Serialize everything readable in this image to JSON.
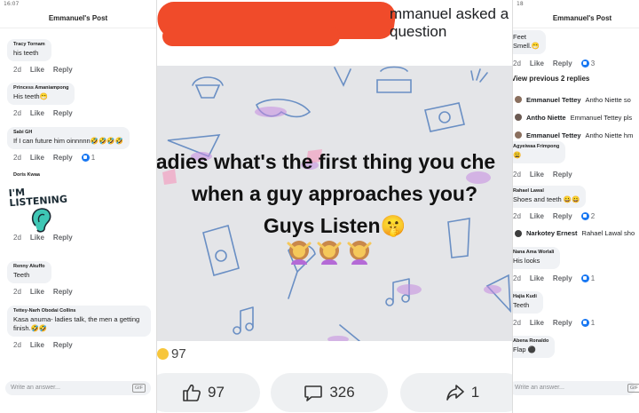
{
  "left_panel": {
    "status_time": "16:07",
    "header": "Emmanuel's Post",
    "comments": [
      {
        "name": "Tracy Tornam",
        "text": "his teeth",
        "time": "2d",
        "like": "Like",
        "reply": "Reply",
        "reactions": ""
      },
      {
        "name": "Princess Amaniampong",
        "text": "His teeth😁",
        "time": "2d",
        "like": "Like",
        "reply": "Reply",
        "reactions": ""
      },
      {
        "name": "Sabi GH",
        "text": "If I can future him oinnnnn🤣🤣🤣🤣",
        "time": "2d",
        "like": "Like",
        "reply": "Reply",
        "reactions": "1"
      },
      {
        "name": "Doris Kwaa",
        "text": "",
        "sticker": "I'M LISTENING",
        "time": "2d",
        "like": "Like",
        "reply": "Reply",
        "reactions": ""
      },
      {
        "name": "Renny Akuffo",
        "text": "Teeth",
        "time": "2d",
        "like": "Like",
        "reply": "Reply",
        "reactions": ""
      },
      {
        "name": "Tettey-Narh Obodai Collins",
        "text": "Kasa anuma- ladies talk, the men a getting finish.🤣🤣",
        "time": "2d",
        "like": "Like",
        "reply": "Reply",
        "reactions": ""
      }
    ],
    "composer_placeholder": "Write an answer...",
    "gif_label": "GIF"
  },
  "center": {
    "title_suffix": "mmanuel asked a question",
    "post_line1": "adies what's the first thing you che",
    "post_line2": "when a guy approaches you?",
    "post_line3": "Guys Listen🤫",
    "reaction_count": "97",
    "like_count": "97",
    "comment_count": "326",
    "share_count": "1"
  },
  "right_panel": {
    "status_time": "18",
    "header": "Emmanuel's Post",
    "top_bubble": "Feet\nSmell.😁",
    "top_time": "2d",
    "top_like": "Like",
    "top_reply": "Reply",
    "top_reactions": "3",
    "view_previous": "View previous 2 replies",
    "replies": [
      {
        "name": "Emmanuel Tettey",
        "text": "Antho Niette so"
      },
      {
        "name": "Antho Niette",
        "text": "Emmanuel Tettey pls"
      },
      {
        "name": "Emmanuel Tettey",
        "text": "Antho Niette hm"
      }
    ],
    "comments": [
      {
        "name": "Agyeiwaa Frimpong",
        "text": "😩",
        "time": "2d",
        "like": "Like",
        "reply": "Reply",
        "reactions": ""
      },
      {
        "name": "Rahael Lawal",
        "text": "Shoes and teeth 😀😀",
        "time": "2d",
        "like": "Like",
        "reply": "Reply",
        "reactions": "2"
      },
      {
        "name": "Narkotey Ernest",
        "text": "Rahael Lawal sho",
        "inline": true
      },
      {
        "name": "Nana Ama Worlali",
        "text": "His looks",
        "time": "2d",
        "like": "Like",
        "reply": "Reply",
        "reactions": "1"
      },
      {
        "name": "Hajia Kudi",
        "text": "Teeth",
        "time": "2d",
        "like": "Like",
        "reply": "Reply",
        "reactions": "1"
      },
      {
        "name": "Abena Ronaldo",
        "text": "Flap ⚫",
        "time": "",
        "like": "",
        "reply": "",
        "reactions": ""
      }
    ],
    "composer_placeholder": "Write an answer...",
    "gif_label": "GIF"
  },
  "colors": {
    "redaction": "#f04b2a",
    "like_blue": "#1877f2",
    "image_bg": "#e4e5e8"
  }
}
